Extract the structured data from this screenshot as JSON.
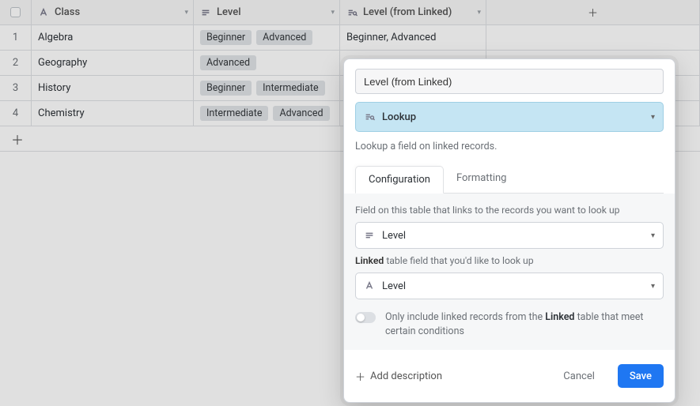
{
  "columns": {
    "class": {
      "label": "Class"
    },
    "level": {
      "label": "Level"
    },
    "lookup": {
      "label": "Level (from Linked)"
    }
  },
  "rows": [
    {
      "n": "1",
      "class": "Algebra",
      "level": [
        "Beginner",
        "Advanced"
      ],
      "lookup": "Beginner, Advanced"
    },
    {
      "n": "2",
      "class": "Geography",
      "level": [
        "Advanced"
      ],
      "lookup": ""
    },
    {
      "n": "3",
      "class": "History",
      "level": [
        "Beginner",
        "Intermediate"
      ],
      "lookup": ""
    },
    {
      "n": "4",
      "class": "Chemistry",
      "level": [
        "Intermediate",
        "Advanced"
      ],
      "lookup": ""
    }
  ],
  "popover": {
    "name_value": "Level (from Linked)",
    "type_label": "Lookup",
    "type_hint": "Lookup a field on linked records.",
    "tabs": {
      "config": "Configuration",
      "format": "Formatting"
    },
    "link_field_label": "Field on this table that links to the records you want to look up",
    "link_field_value": "Level",
    "target_field_label_pre": "",
    "target_field_label_bold": "Linked",
    "target_field_label_post": " table field that you'd like to look up",
    "target_field_value": "Level",
    "conditions_pre": "Only include linked records from the ",
    "conditions_bold": "Linked",
    "conditions_post": " table that meet certain conditions",
    "add_description": "Add description",
    "cancel": "Cancel",
    "save": "Save"
  }
}
